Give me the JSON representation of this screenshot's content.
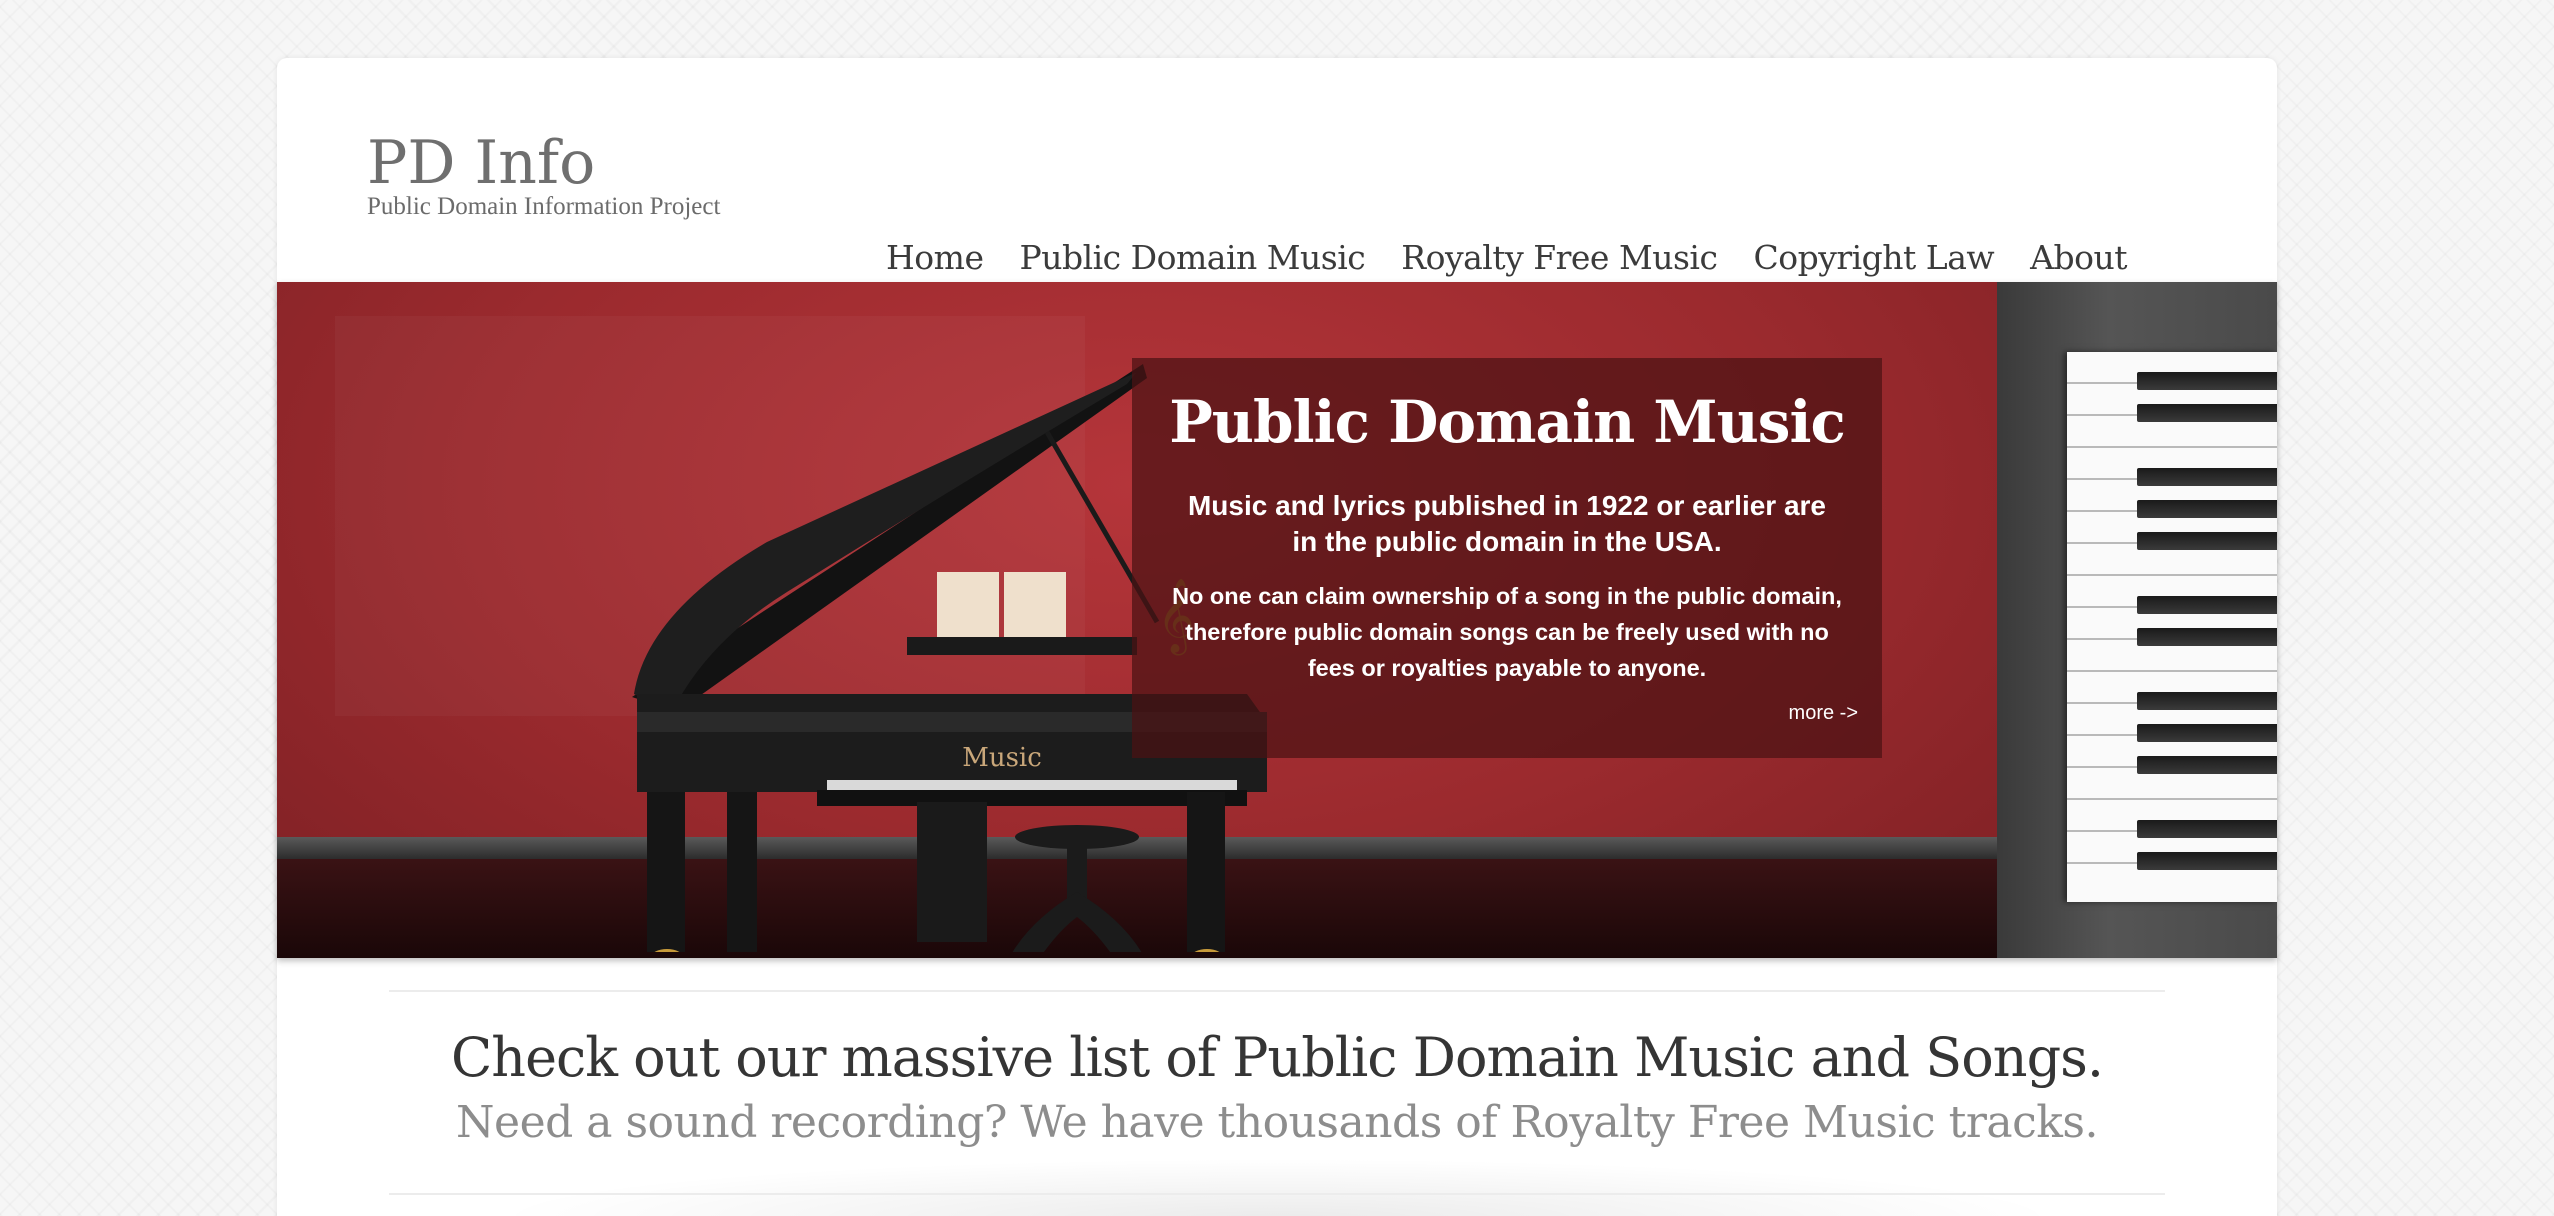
{
  "site": {
    "title": "PD Info",
    "tagline": "Public Domain Information Project"
  },
  "nav": {
    "items": [
      {
        "label": "Home"
      },
      {
        "label": "Public Domain Music"
      },
      {
        "label": "Royalty Free Music"
      },
      {
        "label": "Copyright Law"
      },
      {
        "label": "About"
      }
    ]
  },
  "hero": {
    "title": "Public Domain Music",
    "lead": "Music and lyrics published in 1922 or earlier are in the public domain in the USA.",
    "body": "No one can claim ownership of a song in the public domain, therefore public domain songs can be freely used with no fees or royalties payable to anyone.",
    "more_label": "more ->",
    "piano_label": "Music"
  },
  "promo": {
    "line1": "Check out our massive list of Public Domain Music and Songs.",
    "line2": "Need a sound recording? We have thousands of Royalty Free Music tracks."
  },
  "colors": {
    "hero_red": "#9b2a2e",
    "overlay": "#4b1214",
    "nav_text": "#3b3b3b",
    "promo_primary": "#353535",
    "promo_secondary": "#8d8d8d"
  }
}
